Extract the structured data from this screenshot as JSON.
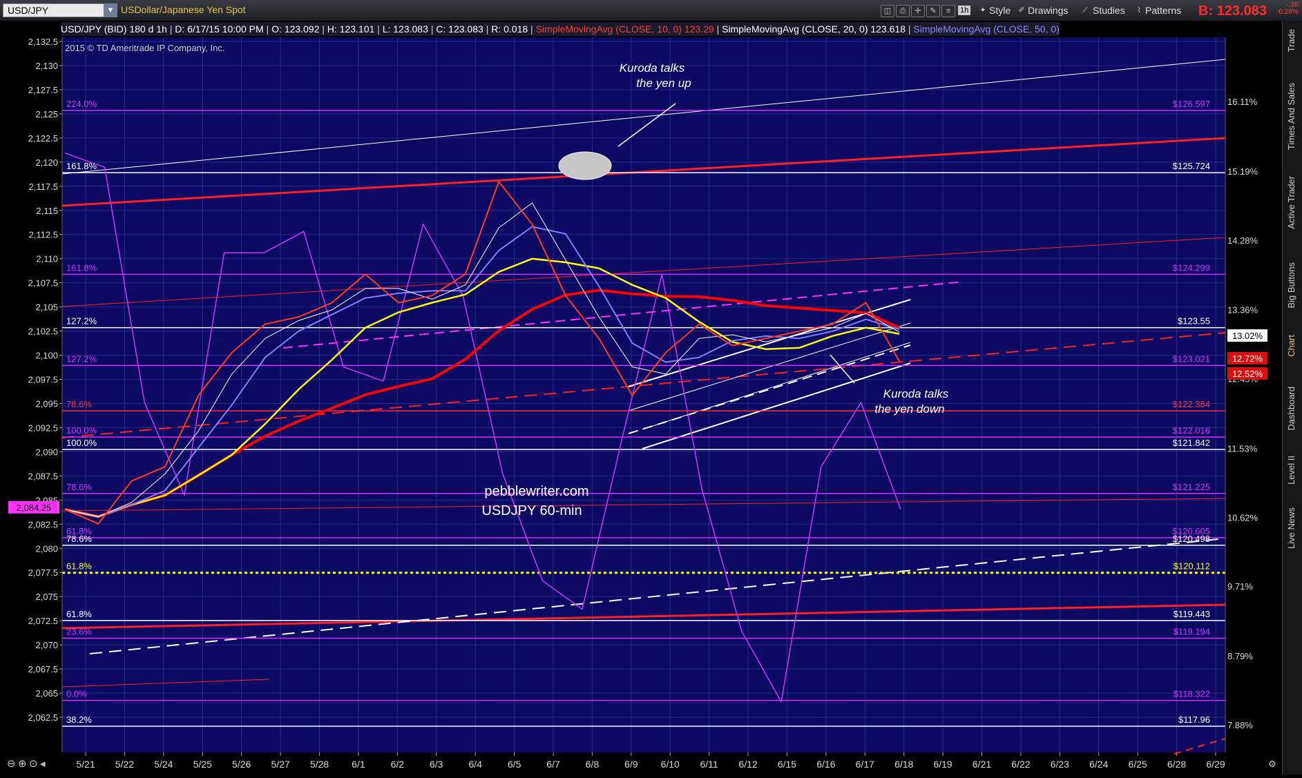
{
  "toolbar": {
    "symbol": "USD/JPY",
    "description": "USDollar/Japanese Yen Spot",
    "aggregation": "1h",
    "style": "Style",
    "drawings": "Drawings",
    "studies": "Studies",
    "patterns": "Patterns",
    "bid": "B: 123.083",
    "bid_change": "-.35",
    "bid_change_pct": "-0.28%"
  },
  "info_bar": {
    "symbol": "USD/JPY (BID) 180 d 1h",
    "date": "D: 6/17/15 10:00 PM",
    "open": "O: 123.092",
    "high": "H: 123.101",
    "low": "L: 123.083",
    "close": "C: 123.083",
    "range": "R: 0.018",
    "sma10": "SimpleMovingAvg (CLOSE, 10, 0)",
    "sma10_val": "123.29",
    "sma20": "SimpleMovingAvg (CLOSE, 20, 0)",
    "sma20_val": "123.618",
    "sma50": "SimpleMovingAvg (CLOSE, 50, 0)"
  },
  "copyright": "2015 © TD Ameritrade IP Company, Inc.",
  "sidebar_tabs": [
    "Trade",
    "Times And Sales",
    "Active Trader",
    "Big Buttons",
    "Chart",
    "Dashboard",
    "Level II",
    "Live News"
  ],
  "annotations": {
    "kuroda_up": [
      "Kuroda talks",
      "the yen up"
    ],
    "kuroda_down": [
      "Kuroda talks",
      "the yen down"
    ],
    "watermark": [
      "pebblewriter.com",
      "USDJPY 60-min"
    ]
  },
  "colors": {
    "background": "#0b0962",
    "grid": "#2a2a8a",
    "price": "#ff3b22",
    "sma10": "#ffffff",
    "sma20": "#ffff00",
    "sma50": "#8080ff",
    "sma200": "#ff0000",
    "overlay": "#cc33ff"
  },
  "chart_data": {
    "type": "line",
    "x_tick_labels": [
      "5/21",
      "5/22",
      "5/24",
      "5/25",
      "5/26",
      "5/27",
      "5/28",
      "6/1",
      "6/2",
      "6/3",
      "6/4",
      "6/5",
      "6/7",
      "6/8",
      "6/9",
      "6/10",
      "6/11",
      "6/12",
      "6/15",
      "6/16",
      "6/17",
      "6/18",
      "6/19",
      "6/21",
      "6/22",
      "6/23",
      "6/24",
      "6/25",
      "6/28",
      "6/29"
    ],
    "left_axis_labels": [
      "2,132.5",
      "2,130",
      "2,127.5",
      "2,125",
      "2,122.5",
      "2,120",
      "2,117.5",
      "2,115",
      "2,112.5",
      "2,110",
      "2,107.5",
      "2,105",
      "2,102.5",
      "2,100",
      "2,097.5",
      "2,095",
      "2,092.5",
      "2,090",
      "2,087.5",
      "2,085",
      "2,082.5",
      "2,080",
      "2,077.5",
      "2,075",
      "2,072.5",
      "2,070",
      "2,067.5",
      "2,065",
      "2,062.5"
    ],
    "left_axis_values": [
      2132.5,
      2130,
      2127.5,
      2125,
      2122.5,
      2120,
      2117.5,
      2115,
      2112.5,
      2110,
      2107.5,
      2105,
      2102.5,
      2100,
      2097.5,
      2095,
      2092.5,
      2090,
      2087.5,
      2085,
      2082.5,
      2080,
      2077.5,
      2075,
      2072.5,
      2070,
      2067.5,
      2065,
      2062.5
    ],
    "left_axis_current": "2,084.25",
    "right_axis_labels": [
      "16.11%",
      "15.19%",
      "14.28%",
      "13.36%",
      "12.45%",
      "11.53%",
      "10.62%",
      "9.71%",
      "8.79%",
      "7.88%"
    ],
    "right_axis_markers": [
      {
        "label": "13.02%",
        "value": 13.02,
        "style": "white"
      },
      {
        "label": "12.72%",
        "value": 12.72,
        "style": "red"
      },
      {
        "label": "12.52%",
        "value": 12.52,
        "style": "red"
      }
    ],
    "fib_levels": [
      {
        "pct": "224.0%",
        "price": "126.597",
        "value": 126.597,
        "color": "#cc33ff"
      },
      {
        "pct": "161.8%",
        "price": "125.724",
        "value": 125.724,
        "color": "#ffffff"
      },
      {
        "pct": "161.8%",
        "price": "124.299",
        "value": 124.299,
        "color": "#cc33ff"
      },
      {
        "pct": "127.2%",
        "price": "123.55",
        "value": 123.55,
        "color": "#ffffff"
      },
      {
        "pct": "127.2%",
        "price": "123.021",
        "value": 123.021,
        "color": "#cc33ff"
      },
      {
        "pct": "78.6%",
        "price": "122.384",
        "value": 122.384,
        "color": "#ff3333"
      },
      {
        "pct": "100.0%",
        "price": "122.016",
        "value": 122.016,
        "color": "#cc33ff"
      },
      {
        "pct": "100.0%",
        "price": "121.842",
        "value": 121.842,
        "color": "#ffffff"
      },
      {
        "pct": "78.6%",
        "price": "121.225",
        "value": 121.225,
        "color": "#cc33ff"
      },
      {
        "pct": "61.8%",
        "price": "120.605",
        "value": 120.605,
        "color": "#cc33ff"
      },
      {
        "pct": "78.6%",
        "price": "120.498",
        "value": 120.498,
        "color": "#ffffff"
      },
      {
        "pct": "61.8%",
        "price": "120.112",
        "value": 120.112,
        "color": "#ffff00"
      },
      {
        "pct": "61.8%",
        "price": "119.443",
        "value": 119.443,
        "color": "#ffffff"
      },
      {
        "pct": "23.6%",
        "price": "119.194",
        "value": 119.194,
        "color": "#cc33ff"
      },
      {
        "pct": "0.0%",
        "price": "118.322",
        "value": 118.322,
        "color": "#cc33ff"
      },
      {
        "pct": "38.2%",
        "price": "117.96",
        "value": 117.96,
        "color": "#ffffff"
      }
    ],
    "price_series_approx": [
      121.0,
      120.8,
      121.4,
      121.6,
      122.6,
      123.2,
      123.6,
      123.7,
      123.9,
      124.3,
      123.9,
      124.0,
      124.3,
      125.6,
      125.0,
      124.0,
      123.4,
      122.6,
      123.2,
      123.6,
      123.3,
      123.4,
      123.5,
      123.6,
      123.9,
      123.08
    ],
    "overlay_series_approx": [
      126.0,
      125.8,
      122.5,
      121.2,
      124.6,
      124.6,
      124.9,
      123.0,
      122.8,
      125.0,
      124.0,
      121.5,
      120.0,
      119.6,
      122.0,
      124.3,
      121.3,
      119.3,
      118.3,
      121.6,
      122.5,
      121.0
    ]
  }
}
